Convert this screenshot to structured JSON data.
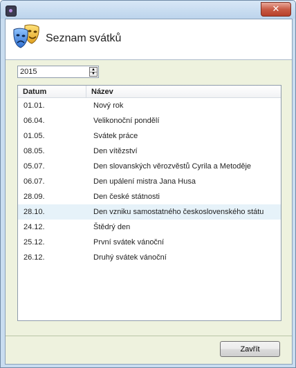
{
  "header": {
    "title": "Seznam svátků"
  },
  "year_picker": {
    "value": "2015"
  },
  "table": {
    "columns": [
      "Datum",
      "Název"
    ],
    "rows": [
      {
        "date": "01.01.",
        "name": "Nový rok"
      },
      {
        "date": "06.04.",
        "name": "Velikonoční pondělí"
      },
      {
        "date": "01.05.",
        "name": "Svátek práce"
      },
      {
        "date": "08.05.",
        "name": "Den vítězství"
      },
      {
        "date": "05.07.",
        "name": "Den slovanských věrozvěstů Cyrila a Metoděje"
      },
      {
        "date": "06.07.",
        "name": "Den upálení mistra Jana Husa"
      },
      {
        "date": "28.09.",
        "name": "Den české státnosti"
      },
      {
        "date": "28.10.",
        "name": "Den vzniku samostatného československého státu"
      },
      {
        "date": "24.12.",
        "name": "Štědrý den"
      },
      {
        "date": "25.12.",
        "name": "První svátek vánoční"
      },
      {
        "date": "26.12.",
        "name": "Druhý svátek vánoční"
      }
    ],
    "selected_row": 7
  },
  "buttons": {
    "close": "Zavřít",
    "window_close": "✕"
  },
  "icons": {
    "app": "app-icon",
    "header": "theater-masks-icon"
  }
}
